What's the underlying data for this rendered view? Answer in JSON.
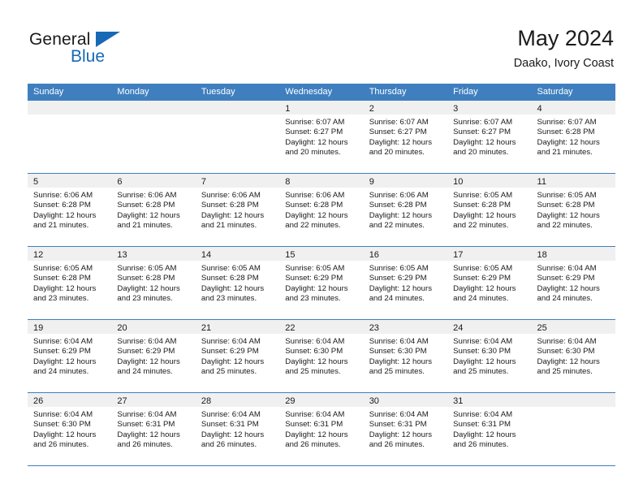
{
  "brand": {
    "word_one": "General",
    "word_two": "Blue",
    "flag_icon": "triangle-flag-icon",
    "accent_color": "#1769b5"
  },
  "header": {
    "title": "May 2024",
    "subtitle": "Daako, Ivory Coast"
  },
  "theme": {
    "header_blue": "#3f7fbf",
    "day_number_bg": "#f0f0f0",
    "text": "#1a1a1a"
  },
  "weekdays": [
    "Sunday",
    "Monday",
    "Tuesday",
    "Wednesday",
    "Thursday",
    "Friday",
    "Saturday"
  ],
  "weeks": [
    [
      {
        "day": "",
        "lines": []
      },
      {
        "day": "",
        "lines": []
      },
      {
        "day": "",
        "lines": []
      },
      {
        "day": "1",
        "lines": [
          "Sunrise: 6:07 AM",
          "Sunset: 6:27 PM",
          "Daylight: 12 hours and 20 minutes."
        ]
      },
      {
        "day": "2",
        "lines": [
          "Sunrise: 6:07 AM",
          "Sunset: 6:27 PM",
          "Daylight: 12 hours and 20 minutes."
        ]
      },
      {
        "day": "3",
        "lines": [
          "Sunrise: 6:07 AM",
          "Sunset: 6:27 PM",
          "Daylight: 12 hours and 20 minutes."
        ]
      },
      {
        "day": "4",
        "lines": [
          "Sunrise: 6:07 AM",
          "Sunset: 6:28 PM",
          "Daylight: 12 hours and 21 minutes."
        ]
      }
    ],
    [
      {
        "day": "5",
        "lines": [
          "Sunrise: 6:06 AM",
          "Sunset: 6:28 PM",
          "Daylight: 12 hours and 21 minutes."
        ]
      },
      {
        "day": "6",
        "lines": [
          "Sunrise: 6:06 AM",
          "Sunset: 6:28 PM",
          "Daylight: 12 hours and 21 minutes."
        ]
      },
      {
        "day": "7",
        "lines": [
          "Sunrise: 6:06 AM",
          "Sunset: 6:28 PM",
          "Daylight: 12 hours and 21 minutes."
        ]
      },
      {
        "day": "8",
        "lines": [
          "Sunrise: 6:06 AM",
          "Sunset: 6:28 PM",
          "Daylight: 12 hours and 22 minutes."
        ]
      },
      {
        "day": "9",
        "lines": [
          "Sunrise: 6:06 AM",
          "Sunset: 6:28 PM",
          "Daylight: 12 hours and 22 minutes."
        ]
      },
      {
        "day": "10",
        "lines": [
          "Sunrise: 6:05 AM",
          "Sunset: 6:28 PM",
          "Daylight: 12 hours and 22 minutes."
        ]
      },
      {
        "day": "11",
        "lines": [
          "Sunrise: 6:05 AM",
          "Sunset: 6:28 PM",
          "Daylight: 12 hours and 22 minutes."
        ]
      }
    ],
    [
      {
        "day": "12",
        "lines": [
          "Sunrise: 6:05 AM",
          "Sunset: 6:28 PM",
          "Daylight: 12 hours and 23 minutes."
        ]
      },
      {
        "day": "13",
        "lines": [
          "Sunrise: 6:05 AM",
          "Sunset: 6:28 PM",
          "Daylight: 12 hours and 23 minutes."
        ]
      },
      {
        "day": "14",
        "lines": [
          "Sunrise: 6:05 AM",
          "Sunset: 6:28 PM",
          "Daylight: 12 hours and 23 minutes."
        ]
      },
      {
        "day": "15",
        "lines": [
          "Sunrise: 6:05 AM",
          "Sunset: 6:29 PM",
          "Daylight: 12 hours and 23 minutes."
        ]
      },
      {
        "day": "16",
        "lines": [
          "Sunrise: 6:05 AM",
          "Sunset: 6:29 PM",
          "Daylight: 12 hours and 24 minutes."
        ]
      },
      {
        "day": "17",
        "lines": [
          "Sunrise: 6:05 AM",
          "Sunset: 6:29 PM",
          "Daylight: 12 hours and 24 minutes."
        ]
      },
      {
        "day": "18",
        "lines": [
          "Sunrise: 6:04 AM",
          "Sunset: 6:29 PM",
          "Daylight: 12 hours and 24 minutes."
        ]
      }
    ],
    [
      {
        "day": "19",
        "lines": [
          "Sunrise: 6:04 AM",
          "Sunset: 6:29 PM",
          "Daylight: 12 hours and 24 minutes."
        ]
      },
      {
        "day": "20",
        "lines": [
          "Sunrise: 6:04 AM",
          "Sunset: 6:29 PM",
          "Daylight: 12 hours and 24 minutes."
        ]
      },
      {
        "day": "21",
        "lines": [
          "Sunrise: 6:04 AM",
          "Sunset: 6:29 PM",
          "Daylight: 12 hours and 25 minutes."
        ]
      },
      {
        "day": "22",
        "lines": [
          "Sunrise: 6:04 AM",
          "Sunset: 6:30 PM",
          "Daylight: 12 hours and 25 minutes."
        ]
      },
      {
        "day": "23",
        "lines": [
          "Sunrise: 6:04 AM",
          "Sunset: 6:30 PM",
          "Daylight: 12 hours and 25 minutes."
        ]
      },
      {
        "day": "24",
        "lines": [
          "Sunrise: 6:04 AM",
          "Sunset: 6:30 PM",
          "Daylight: 12 hours and 25 minutes."
        ]
      },
      {
        "day": "25",
        "lines": [
          "Sunrise: 6:04 AM",
          "Sunset: 6:30 PM",
          "Daylight: 12 hours and 25 minutes."
        ]
      }
    ],
    [
      {
        "day": "26",
        "lines": [
          "Sunrise: 6:04 AM",
          "Sunset: 6:30 PM",
          "Daylight: 12 hours and 26 minutes."
        ]
      },
      {
        "day": "27",
        "lines": [
          "Sunrise: 6:04 AM",
          "Sunset: 6:31 PM",
          "Daylight: 12 hours and 26 minutes."
        ]
      },
      {
        "day": "28",
        "lines": [
          "Sunrise: 6:04 AM",
          "Sunset: 6:31 PM",
          "Daylight: 12 hours and 26 minutes."
        ]
      },
      {
        "day": "29",
        "lines": [
          "Sunrise: 6:04 AM",
          "Sunset: 6:31 PM",
          "Daylight: 12 hours and 26 minutes."
        ]
      },
      {
        "day": "30",
        "lines": [
          "Sunrise: 6:04 AM",
          "Sunset: 6:31 PM",
          "Daylight: 12 hours and 26 minutes."
        ]
      },
      {
        "day": "31",
        "lines": [
          "Sunrise: 6:04 AM",
          "Sunset: 6:31 PM",
          "Daylight: 12 hours and 26 minutes."
        ]
      },
      {
        "day": "",
        "lines": []
      }
    ]
  ]
}
